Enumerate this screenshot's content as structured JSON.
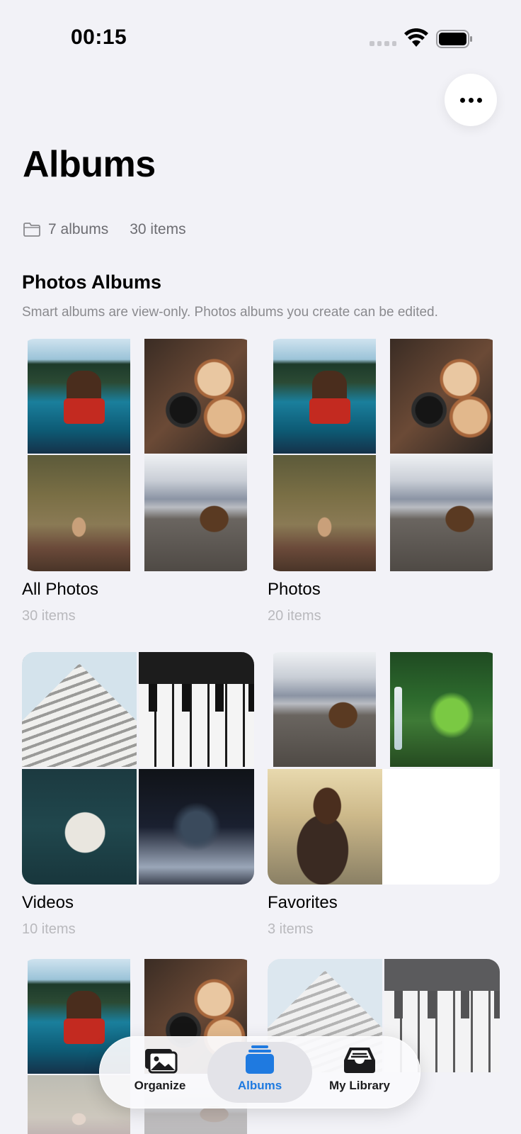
{
  "status": {
    "time": "00:15"
  },
  "header": {
    "title": "Albums",
    "more_label": "More"
  },
  "summary": {
    "albums": "7 albums",
    "items": "30 items"
  },
  "section": {
    "title": "Photos Albums",
    "subtitle": "Smart albums are view-only. Photos albums you create can be edited."
  },
  "albums": [
    {
      "name": "All Photos",
      "count": "30 items"
    },
    {
      "name": "Photos",
      "count": "20 items"
    },
    {
      "name": "Videos",
      "count": "10 items"
    },
    {
      "name": "Favorites",
      "count": "3 items"
    }
  ],
  "tabs": [
    {
      "label": "Organize",
      "icon": "photos-stack-icon"
    },
    {
      "label": "Albums",
      "icon": "albums-stack-icon",
      "active": true
    },
    {
      "label": "My Library",
      "icon": "tray-icon"
    }
  ],
  "colors": {
    "accent": "#1f7ae0",
    "background": "#f2f2f7"
  }
}
